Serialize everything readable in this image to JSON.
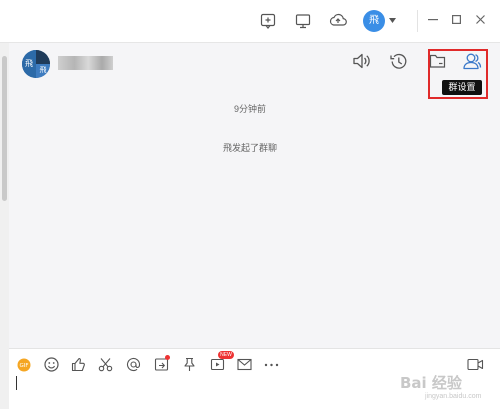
{
  "top_bar": {
    "avatar_text": "飛"
  },
  "chat": {
    "group_name": "",
    "group_avatar_text_left": "飛",
    "group_avatar_text_right": "飛",
    "time_label": "9分钟前",
    "system_message": "飛发起了群聊"
  },
  "header": {
    "tooltip": "群设置"
  },
  "toolbar": {
    "new_badge": "NEW"
  },
  "watermark": {
    "text": "Bai 经验",
    "sub": "jingyan.baidu.com"
  },
  "colors": {
    "accent": "#3a8ee6",
    "highlight": "#e02a2a",
    "chat_bg": "#f5f5f7"
  }
}
